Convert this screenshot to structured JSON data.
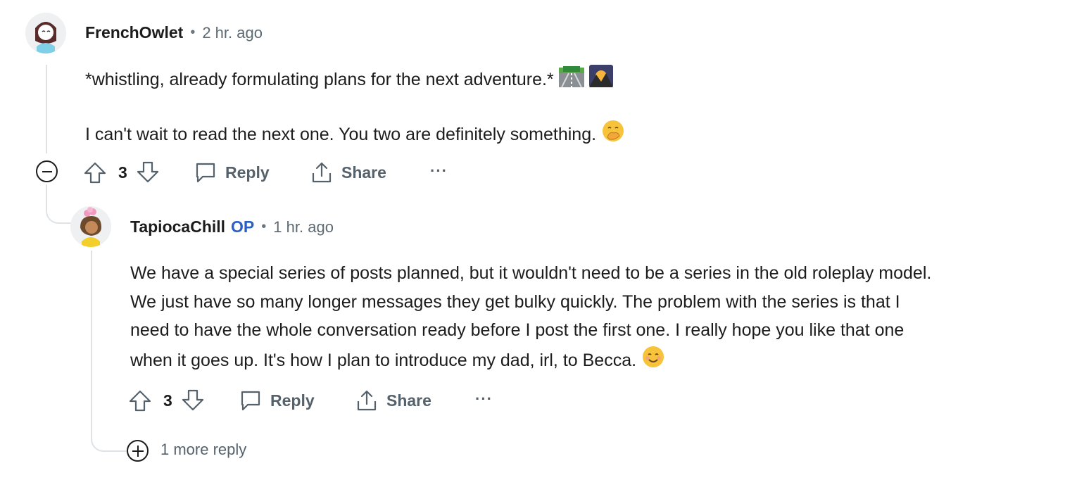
{
  "comments": [
    {
      "author": "FrenchOwlet",
      "op_badge": "",
      "time": "2 hr. ago",
      "lines": [
        "*whistling, already formulating plans for the next adventure.*",
        "I can't wait to read the next one. You two are definitely something."
      ],
      "emojis": [
        "motorway-emoji",
        "sunrise-over-mountains-emoji",
        "hand-over-mouth-emoji"
      ],
      "votes": "3",
      "reply_label": "Reply",
      "share_label": "Share",
      "more_label": "···"
    },
    {
      "author": "TapiocaChill",
      "op_badge": "OP",
      "time": "1 hr. ago",
      "lines": [
        "We have a special series of posts planned, but it wouldn't need to be a series in the old roleplay model.",
        "We just have so many longer messages they get bulky quickly. The problem with the series is that I",
        "need to have the whole conversation ready before I post the first one. I really hope you like that one",
        "when it goes up. It's how I plan to introduce my dad, irl, to Becca."
      ],
      "emojis": [
        "smiling-face-emoji"
      ],
      "votes": "3",
      "reply_label": "Reply",
      "share_label": "Share",
      "more_label": "···"
    }
  ],
  "more_replies_label": "1 more reply",
  "colors": {
    "accent_op": "#2a5fc6",
    "text": "#1c1c1c",
    "muted": "#55626c",
    "thread": "#dfe3e6"
  }
}
